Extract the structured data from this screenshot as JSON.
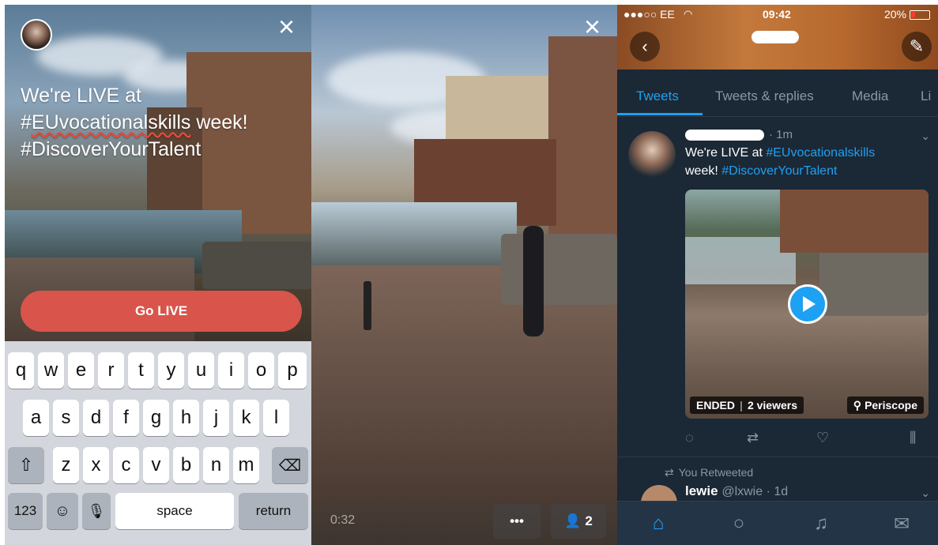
{
  "compose": {
    "title_line1": "We're LIVE at",
    "title_line2a": "#",
    "title_line2b": "EUvocationalskills",
    "title_line2c": " week!",
    "title_line3": "#DiscoverYourTalent",
    "go_live_label": "Go LIVE",
    "close_icon": "×"
  },
  "keyboard": {
    "row1": [
      "q",
      "w",
      "e",
      "r",
      "t",
      "y",
      "u",
      "i",
      "o",
      "p"
    ],
    "row2": [
      "a",
      "s",
      "d",
      "f",
      "g",
      "h",
      "j",
      "k",
      "l"
    ],
    "row3": [
      "z",
      "x",
      "c",
      "v",
      "b",
      "n",
      "m"
    ],
    "numbers_label": "123",
    "space_label": "space",
    "return_label": "return"
  },
  "broadcast": {
    "timer": "0:32",
    "more_label": "•••",
    "viewer_count": "2",
    "close_icon": "×"
  },
  "twitter": {
    "status_carrier": "●●●○○ EE",
    "status_time": "09:42",
    "status_battery": "20%",
    "tabs": [
      "Tweets",
      "Tweets & replies",
      "Media",
      "Li"
    ],
    "tweet": {
      "time": "· 1m",
      "text_a": "We're LIVE at ",
      "hashtag1": "#EUvocationalskills",
      "text_b": "week! ",
      "hashtag2": "#DiscoverYourTalent",
      "badge_ended": "ENDED",
      "badge_viewers": "2 viewers",
      "badge_source": "Periscope"
    },
    "retweet": {
      "context": "You Retweeted",
      "name": "lewie",
      "handle": "@lxwie · 1d"
    },
    "accent": "#1da1f2"
  }
}
